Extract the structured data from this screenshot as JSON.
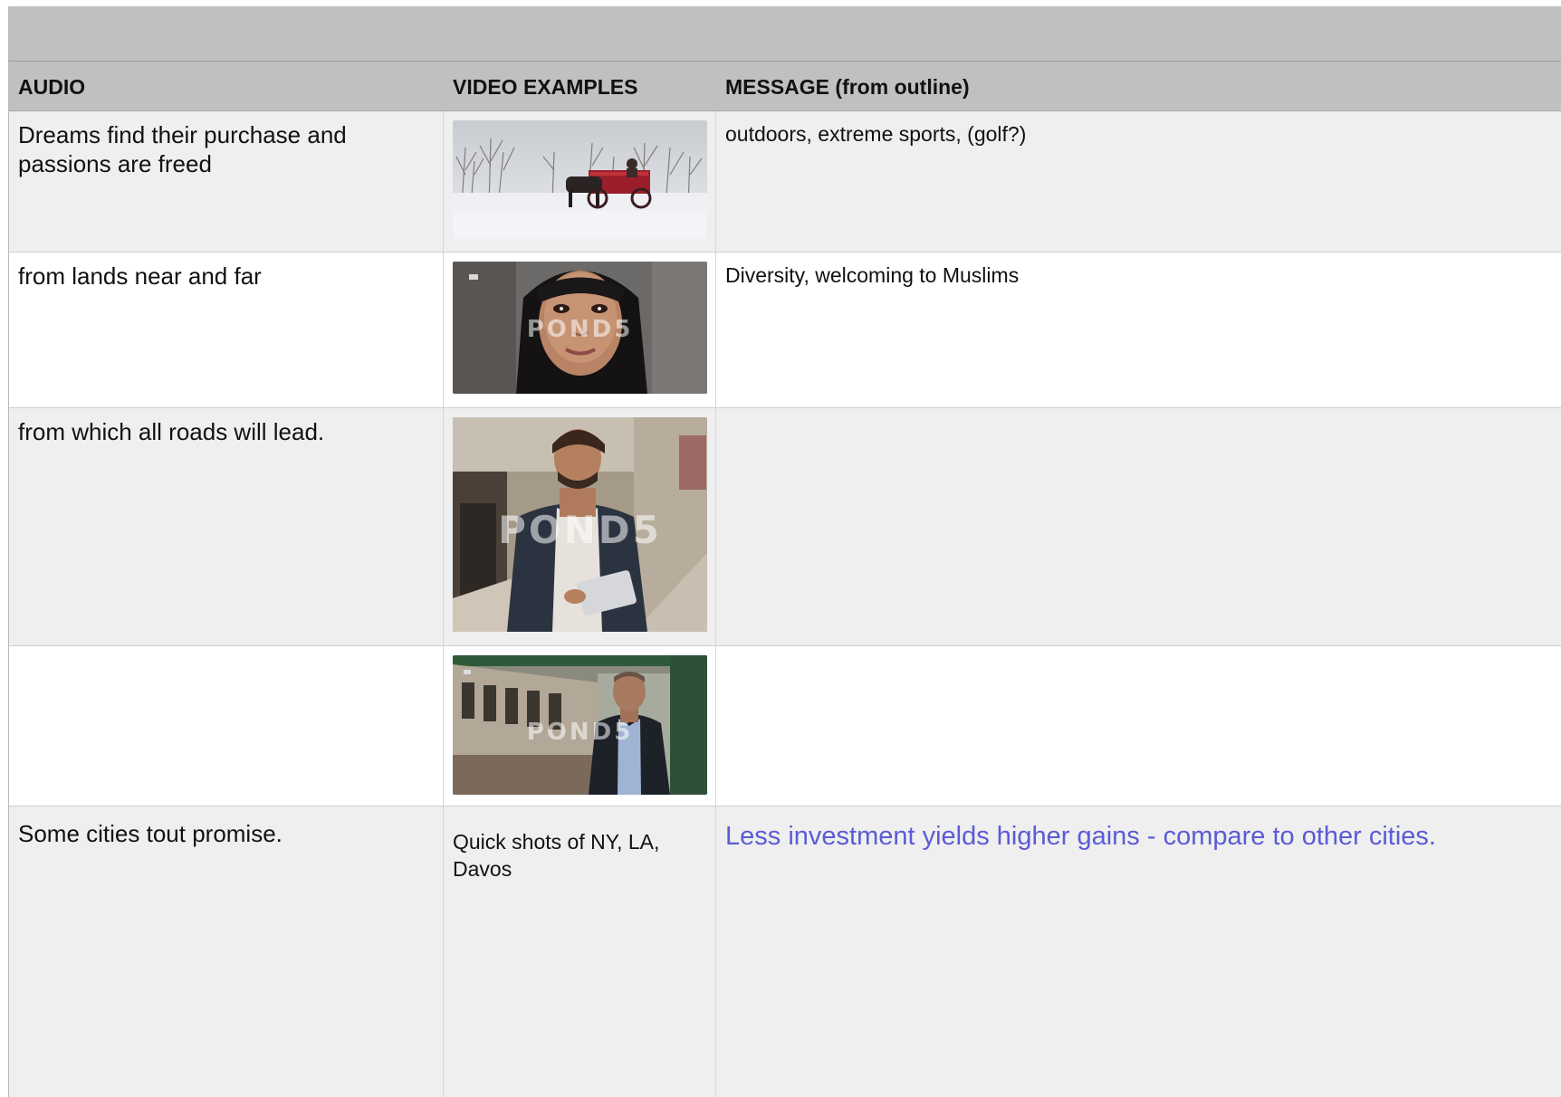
{
  "table": {
    "headers": {
      "audio": "AUDIO",
      "video": "VIDEO EXAMPLES",
      "message": "MESSAGE (from outline)"
    },
    "rows": [
      {
        "audio": "Dreams find their purchase and passions are freed",
        "video_image": "snowy-carriage-ride-image",
        "message": "outdoors, extreme sports, (golf?)"
      },
      {
        "audio": "from lands near and far",
        "video_image": "woman-in-hijab-portrait-image",
        "video_watermark": "POND5",
        "message": "Diversity, welcoming to Muslims"
      },
      {
        "audio": "from which all roads will lead.",
        "video_image": "man-with-tablet-on-stairs-image",
        "video_watermark": "POND5",
        "message": ""
      },
      {
        "audio": "",
        "video_image": "man-beside-train-image",
        "video_watermark": "POND5",
        "message": ""
      },
      {
        "audio": "Some cities tout promise.",
        "video_text": "Quick shots of NY, LA, Davos",
        "message": "Less investment yields higher gains - compare to other cities.",
        "message_color": "#5b5bd6"
      }
    ]
  }
}
